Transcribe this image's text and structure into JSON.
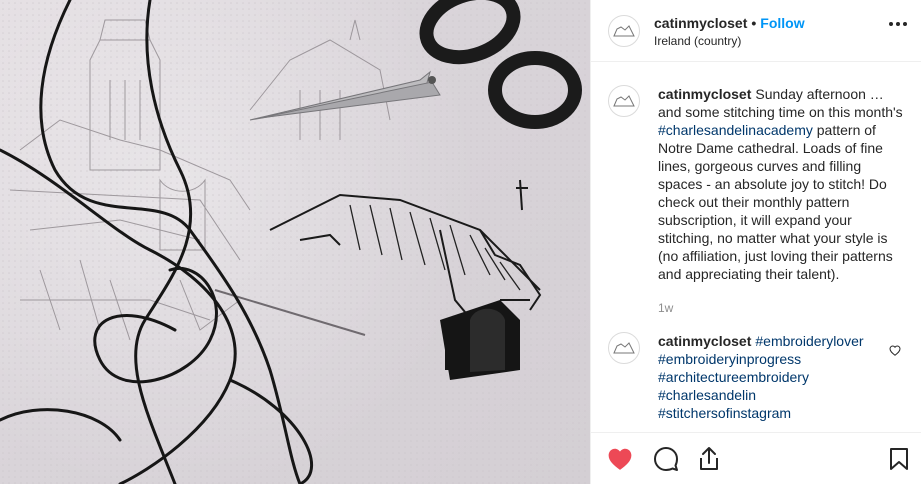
{
  "post": {
    "username": "catinmycloset",
    "separator": "•",
    "follow_label": "Follow",
    "location": "Ireland (country)"
  },
  "photo": {
    "subject": ""
  },
  "comments": [
    {
      "username": "catinmycloset",
      "text_1": "Sunday afternoon … and some stitching time on this month's ",
      "hashtag_1": "#charlesandelinacademy",
      "text_2": " pattern of Notre Dame cathedral. Loads of fine lines, gorgeous curves and filling spaces - an absolute joy to stitch! Do check out their monthly pattern subscription, it will expand your stitching, no matter what your style is (no affiliation, just loving their patterns and appreciating their talent).",
      "time": "1w"
    },
    {
      "username": "catinmycloset",
      "hashtags": [
        "#embroiderylover",
        "#embroideryinprogress",
        "#architectureembroidery",
        "#charlesandelin",
        "#stitchersofinstagram"
      ]
    }
  ],
  "icons": {
    "like": "heart-filled-icon",
    "comment": "comment-icon",
    "share": "share-icon",
    "save": "bookmark-icon",
    "more": "more-dots-icon",
    "comment_like": "heart-outline-icon"
  },
  "colors": {
    "like_red": "#ed4956",
    "follow_blue": "#0095f6",
    "hashtag_blue": "#00376b",
    "muted": "#8e8e8e"
  }
}
